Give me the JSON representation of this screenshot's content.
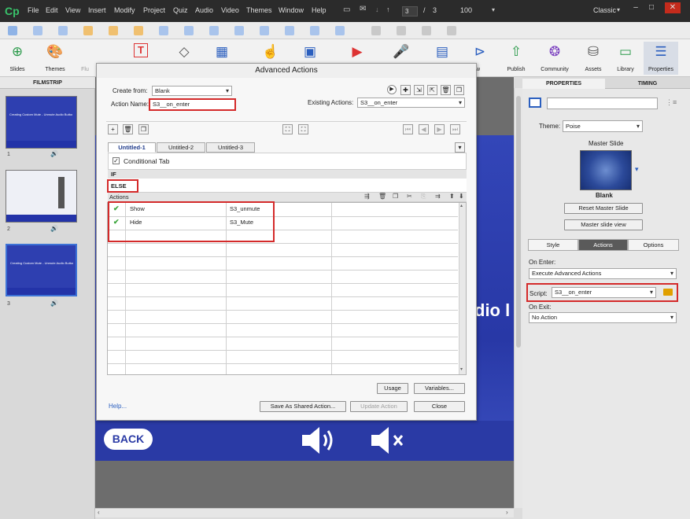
{
  "app": {
    "logo": "Cp",
    "layout_mode": "Classic"
  },
  "menu": [
    "File",
    "Edit",
    "View",
    "Insert",
    "Modify",
    "Project",
    "Quiz",
    "Audio",
    "Video",
    "Themes",
    "Window",
    "Help"
  ],
  "slide_nav": {
    "current": "3",
    "separator": "/",
    "total": "3",
    "zoom": "100"
  },
  "toolbar": [
    {
      "label": "Slides",
      "icon": "plus-circle-icon"
    },
    {
      "label": "Themes",
      "icon": "palette-icon"
    },
    {
      "label": "Flu",
      "icon": "fluid-box-icon"
    },
    {
      "label": "",
      "icon": "text-icon"
    },
    {
      "label": "",
      "icon": "shapes-icon"
    },
    {
      "label": "",
      "icon": "objects-icon"
    },
    {
      "label": "",
      "icon": "interactions-icon"
    },
    {
      "label": "",
      "icon": "media-icon"
    },
    {
      "label": "",
      "icon": "record-icon"
    },
    {
      "label": "",
      "icon": "audio-icon"
    },
    {
      "label": "",
      "icon": "save-icon"
    },
    {
      "label": "view",
      "icon": "preview-icon"
    },
    {
      "label": "Publish",
      "icon": "publish-icon"
    },
    {
      "label": "Community",
      "icon": "community-icon"
    },
    {
      "label": "Assets",
      "icon": "assets-icon"
    },
    {
      "label": "Library",
      "icon": "library-icon"
    },
    {
      "label": "Properties",
      "icon": "properties-icon"
    }
  ],
  "filmstrip": {
    "header": "FILMSTRIP",
    "slides": [
      {
        "number": "1",
        "title": "Creating Custom Mute - Unmute Audio Button"
      },
      {
        "number": "2",
        "title": ""
      },
      {
        "number": "3",
        "title": "Creating Custom Mute - Unmute Audio Button"
      }
    ]
  },
  "stage": {
    "back_label": "BACK",
    "partial_text": "dio l"
  },
  "dialog": {
    "title": "Advanced Actions",
    "create_from_label": "Create from:",
    "create_from_value": "Blank",
    "action_name_label": "Action Name:",
    "action_name_value": "S3__on_enter",
    "existing_actions_label": "Existing Actions:",
    "existing_actions_value": "S3__on_enter",
    "tabs": [
      "Untitled-1",
      "Untitled-2",
      "Untitled-3"
    ],
    "conditional_tab_label": "Conditional Tab",
    "if_label": "IF",
    "else_label": "ELSE",
    "actions_header": "Actions",
    "rows": [
      {
        "action": "Show",
        "target": "S3_unmute"
      },
      {
        "action": "Hide",
        "target": "S3_Mute"
      }
    ],
    "usage_label": "Usage",
    "variables_label": "Variables...",
    "help_label": "Help...",
    "save_shared_label": "Save As Shared Action...",
    "update_label": "Update Action",
    "close_label": "Close"
  },
  "properties": {
    "tab_properties": "PROPERTIES",
    "tab_timing": "TIMING",
    "theme_label": "Theme:",
    "theme_value": "Poise",
    "master_slide_label": "Master Slide",
    "master_name": "Blank",
    "reset_label": "Reset Master Slide",
    "master_view_label": "Master slide view",
    "subtabs": [
      "Style",
      "Actions",
      "Options"
    ],
    "on_enter_label": "On Enter:",
    "on_enter_value": "Execute Advanced Actions",
    "script_label": "Script:",
    "script_value": "S3__on_enter",
    "on_exit_label": "On Exit:",
    "on_exit_value": "No Action"
  },
  "colors": {
    "accent": "#3d72d6",
    "highlight": "#d42a2a",
    "stage_blue": "#2a3aa5"
  }
}
